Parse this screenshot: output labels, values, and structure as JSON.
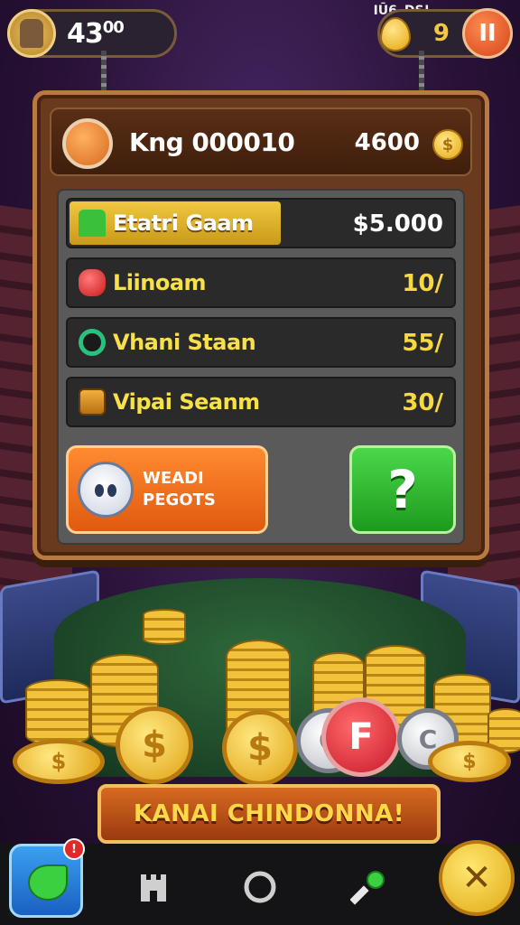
{
  "status_bar": {
    "signal_text": "IŪ6",
    "right_text": "DS!"
  },
  "hud": {
    "player_level": "43",
    "player_level_suffix": "00",
    "gem_count": "9",
    "pause_label": "II"
  },
  "board": {
    "title": "Kng 000010",
    "score": "4600",
    "coin_symbol": "$",
    "rows": [
      {
        "label": "Etatri Gaam",
        "value": "$5.000",
        "icon": "grass-icon",
        "highlight": true
      },
      {
        "label": "Liinoam",
        "value": "10/",
        "icon": "red-gem-icon",
        "highlight": false
      },
      {
        "label": "Vhani Staan",
        "value": "55/",
        "icon": "green-ring-icon",
        "highlight": false
      },
      {
        "label": "Vipai Seanm",
        "value": "30/",
        "icon": "gift-box-icon",
        "highlight": false
      }
    ],
    "orange_button": {
      "line1": "WEADI",
      "line2": "PEGOTS"
    },
    "help_button": "?"
  },
  "coins": {
    "gold_symbol": "$",
    "red_symbol": "F",
    "silver_symbol": "C"
  },
  "banner": {
    "text": "KANAI CHINDONNA!"
  },
  "nav": {
    "notification_count": "!",
    "close_label": "✕"
  },
  "colors": {
    "accent_gold": "#f8d840",
    "board_wood": "#6a3a1e",
    "green_button": "#1e9a1e",
    "orange_button": "#e05a10"
  }
}
